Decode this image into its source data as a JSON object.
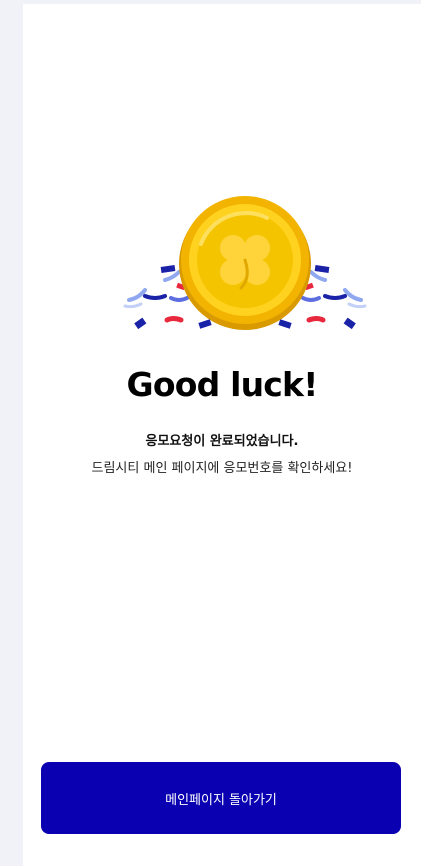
{
  "result": {
    "headline": "Good luck!",
    "subtitle": "응모요청이 완료되었습니다.",
    "description": "드림시티 메인 페이지에 응모번호를 확인하세요!"
  },
  "illustration": {
    "icon": "clover-coin-icon",
    "coin_color": "#f5c400",
    "clover_color": "#ffd43b",
    "confetti_colors": [
      "#1a22a8",
      "#e8283c",
      "#8fa8f0"
    ]
  },
  "footer": {
    "button_label": "메인페이지 돌아가기",
    "button_color": "#0a00b2"
  }
}
